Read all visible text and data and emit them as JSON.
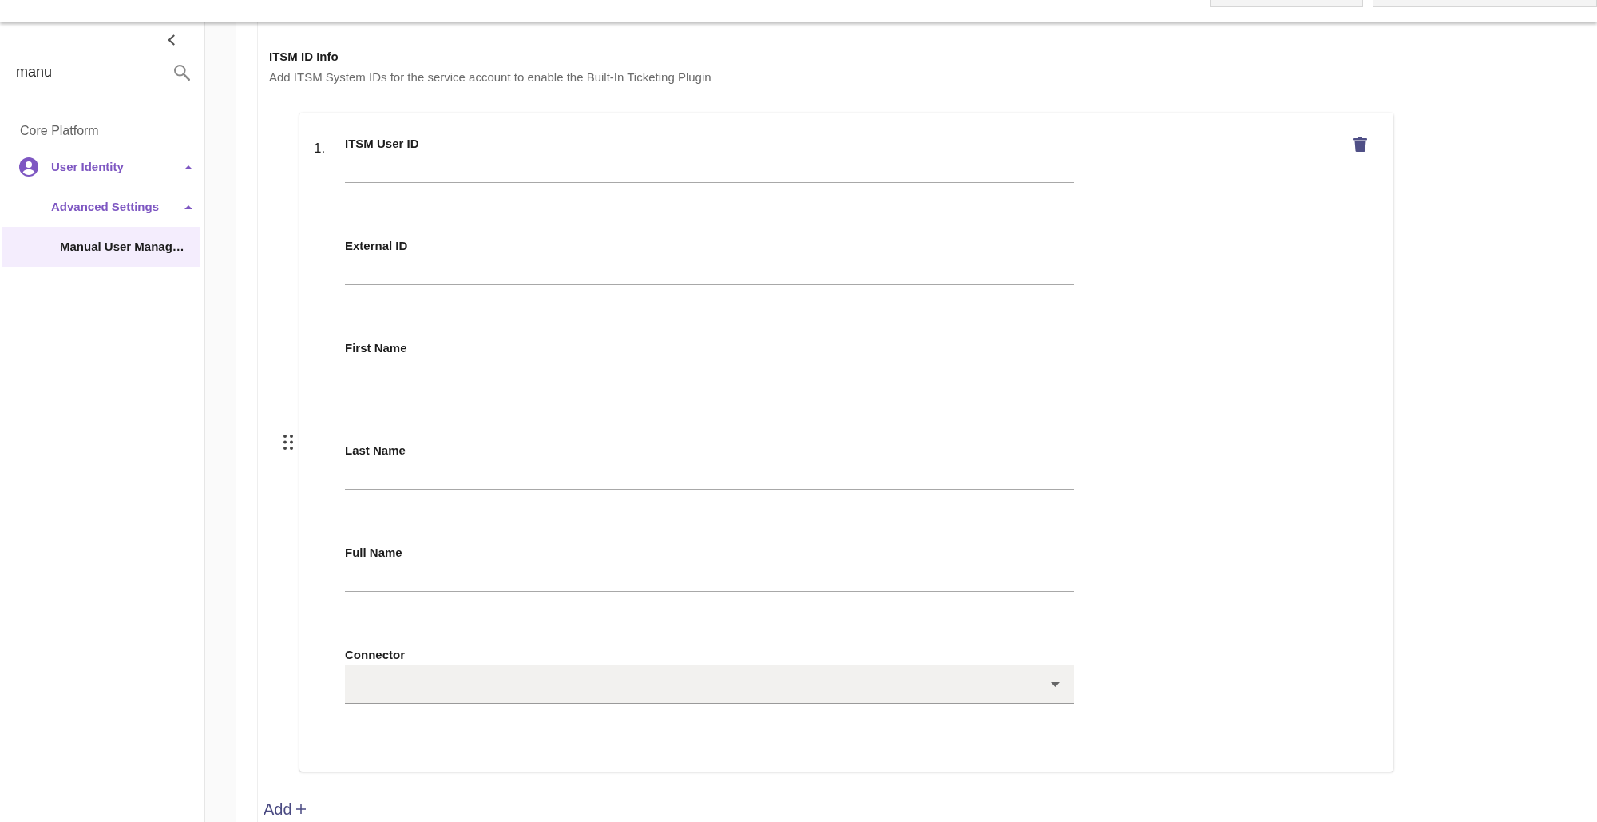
{
  "sidebar": {
    "search": {
      "value": "manu"
    },
    "section": "Core Platform",
    "items": [
      {
        "label": "User Identity",
        "expanded": true,
        "selected": false,
        "children": [
          {
            "label": "Advanced Settings",
            "expanded": true,
            "selected": false,
            "children": [
              {
                "label": "Manual User Manag…",
                "selected": true
              }
            ]
          }
        ]
      }
    ]
  },
  "main": {
    "title": "ITSM ID Info",
    "description": "Add ITSM System IDs for the service account to enable the Built-In Ticketing Plugin",
    "entries": [
      {
        "number": "1.",
        "fields": [
          {
            "label": "ITSM User ID",
            "kind": "text"
          },
          {
            "label": "External ID",
            "kind": "text"
          },
          {
            "label": "First Name",
            "kind": "text"
          },
          {
            "label": "Last Name",
            "kind": "text"
          },
          {
            "label": "Full Name",
            "kind": "text"
          },
          {
            "label": "Connector",
            "kind": "select"
          }
        ]
      }
    ],
    "add_button": {
      "label": "Add"
    }
  }
}
